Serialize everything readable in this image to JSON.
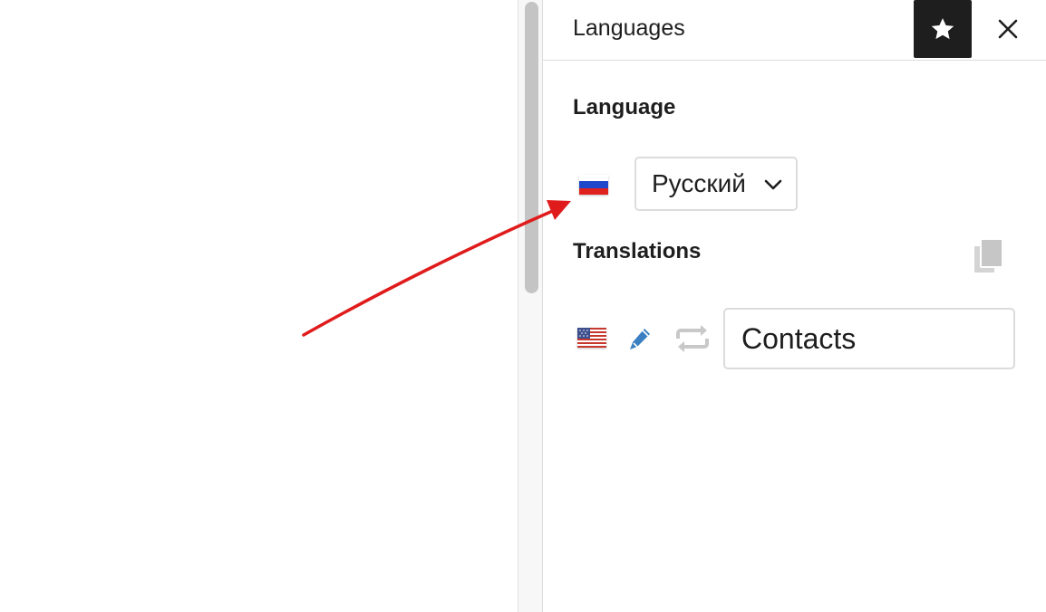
{
  "panel": {
    "title": "Languages",
    "star_icon": "star-icon",
    "close_icon": "close-icon"
  },
  "language_section": {
    "heading": "Language",
    "flag": "russia-flag-icon",
    "selected_language": "Русский",
    "dropdown_icon": "chevron-down-icon"
  },
  "translations_section": {
    "heading": "Translations",
    "copy_icon": "copy-icon",
    "items": [
      {
        "flag": "usa-flag-icon",
        "edit_icon": "pencil-icon",
        "sync_icon": "sync-icon",
        "value": "Contacts"
      }
    ]
  },
  "annotation": {
    "arrow_color": "#e01b1b"
  },
  "colors": {
    "text": "#1e1e1e",
    "accent_blue": "#3a7fc1",
    "border": "#dcdcdc",
    "muted_icon": "#c8c8c8"
  }
}
